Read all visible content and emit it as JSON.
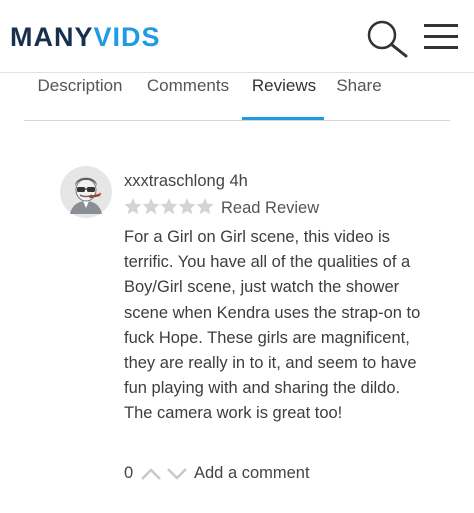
{
  "header": {
    "logo_part1": "MANY",
    "logo_part2": "VIDS",
    "search_icon": "search-icon",
    "menu_icon": "hamburger-menu-icon"
  },
  "tabs": [
    {
      "label": "Description",
      "active": false
    },
    {
      "label": "Comments",
      "active": false
    },
    {
      "label": "Reviews",
      "active": true
    },
    {
      "label": "Share",
      "active": false
    }
  ],
  "review": {
    "username": "xxxtraschlong",
    "time_ago": "4h",
    "rating": 0,
    "rating_max": 5,
    "read_review_label": "Read Review",
    "body": [
      "For a Girl on Girl scene, this video is terrific. You have all of the qualities of a Boy/Girl scene, just watch the shower scene when Kendra uses the strap-on to fuck Hope. These girls are magnificent, they are really in to it, and seem to have fun playing with and sharing the dildo.",
      "The camera work is great too!"
    ],
    "vote_count": "0",
    "add_comment_label": "Add a comment"
  },
  "colors": {
    "brand_dark": "#17304d",
    "brand_blue": "#1f9be3",
    "star_gray": "#d6d6d6",
    "text": "#3d3d3d"
  }
}
